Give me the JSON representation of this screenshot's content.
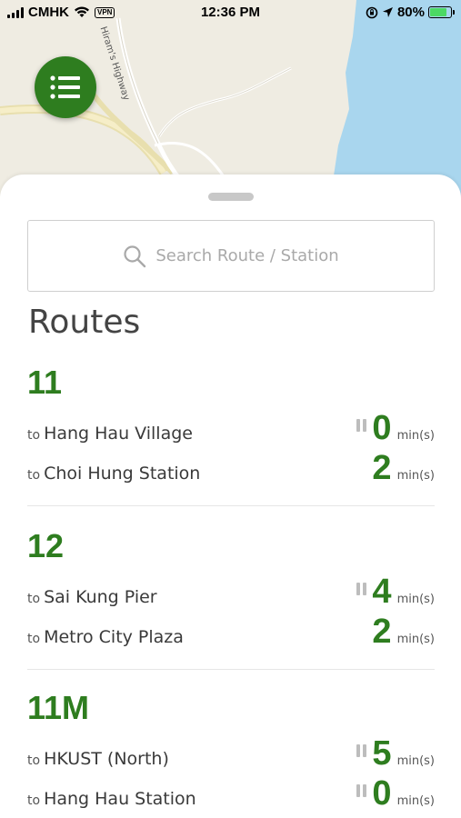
{
  "status_bar": {
    "carrier": "CMHK",
    "vpn": "VPN",
    "time": "12:36 PM",
    "battery": "80%",
    "battery_level": 0.8
  },
  "map": {
    "road_label": "Hiram's Highway"
  },
  "menu_button": {
    "icon": "list-icon"
  },
  "search": {
    "placeholder": "Search Route / Station",
    "icon": "search-icon"
  },
  "page_title": "Routes",
  "colors": {
    "accent": "#2e7d1f",
    "water": "#a9d6ee"
  },
  "routes": [
    {
      "number": "11",
      "destinations": [
        {
          "prefix": "to",
          "name": "Hang Hau Village",
          "eta": "0",
          "unit": "min(s)",
          "paused": true
        },
        {
          "prefix": "to",
          "name": "Choi Hung Station",
          "eta": "2",
          "unit": "min(s)",
          "paused": false
        }
      ]
    },
    {
      "number": "12",
      "destinations": [
        {
          "prefix": "to",
          "name": "Sai Kung Pier",
          "eta": "4",
          "unit": "min(s)",
          "paused": true
        },
        {
          "prefix": "to",
          "name": "Metro City Plaza",
          "eta": "2",
          "unit": "min(s)",
          "paused": false
        }
      ]
    },
    {
      "number": "11M",
      "destinations": [
        {
          "prefix": "to",
          "name": "HKUST (North)",
          "eta": "5",
          "unit": "min(s)",
          "paused": true
        },
        {
          "prefix": "to",
          "name": "Hang Hau Station",
          "eta": "0",
          "unit": "min(s)",
          "paused": true
        }
      ]
    }
  ]
}
